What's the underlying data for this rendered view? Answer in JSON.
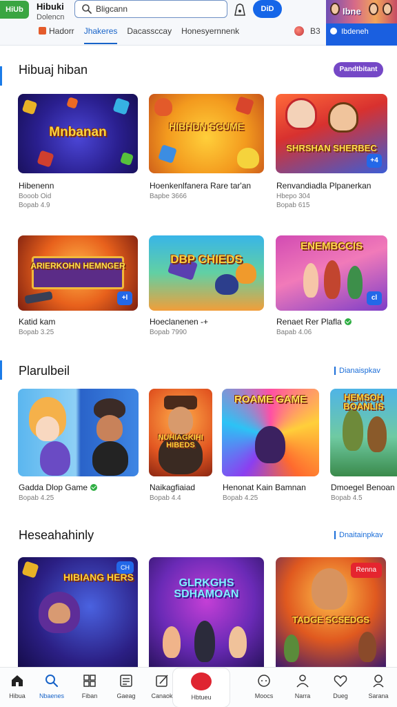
{
  "header": {
    "logo_text": "HiUb",
    "brand_title": "Hibuki",
    "brand_sub": "Dolencn",
    "search_value": "Bligcann",
    "go_label": "DiD",
    "nav_links": [
      "Hadorr",
      "Jhakeres",
      "Dacassccay",
      "Honesyernnenk"
    ],
    "count": "B3"
  },
  "promo": {
    "title": "Ibne",
    "label": "Ibdeneh"
  },
  "sections": [
    {
      "title": "Hibuaj hiban",
      "action": "Pandtbitant",
      "cards": [
        {
          "thumb_title": "Mnbanan",
          "name": "Hibenenn",
          "meta1": "Booob Oid",
          "meta2": "Bopab 4.9",
          "badge": ""
        },
        {
          "thumb_title": "HIBHDN SCUME",
          "name": "Hoenkenlfanera Rare tar'an",
          "meta1": "Bapbe 3666",
          "meta2": "",
          "badge": ""
        },
        {
          "thumb_title": "SHRSHAN SHERBEC",
          "name": "Renvandiadla Plpanerkan",
          "meta1": "Hbepo 304",
          "meta2": "Bopab 615",
          "badge": "+4"
        }
      ]
    },
    {
      "title": "",
      "action": "",
      "cards": [
        {
          "thumb_title": "ARIERKOHN HEMNGER",
          "name": "Katid kam",
          "meta1": "Bopab 3.25",
          "meta2": "",
          "badge": "+l"
        },
        {
          "thumb_title": "DBP CHIEDS",
          "name": "Hoeclanenen -+",
          "meta1": "Bopab 7990",
          "meta2": "",
          "badge": ""
        },
        {
          "thumb_title": "ENEMBCCIS",
          "name": "Renaet Rer Plafla",
          "meta1": "Bapab 4.06",
          "meta2": "",
          "badge": "cl"
        }
      ]
    },
    {
      "title": "Plarulbeil",
      "action": "Dianaispkav",
      "cards": [
        {
          "thumb_title": "",
          "name": "Gadda Dlop Game",
          "meta1": "Bopab 4.25",
          "meta2": "",
          "badge": ""
        },
        {
          "thumb_title": "NUHIAGKIHI HIBEDS",
          "name": "Naikagfiaiad",
          "meta1": "Bopab 4.4",
          "meta2": "",
          "badge": ""
        },
        {
          "thumb_title": "ROAME GAME",
          "name": "Henonat Kain Bamnan",
          "meta1": "Bopab 4.25",
          "meta2": "",
          "badge": ""
        },
        {
          "thumb_title": "HEMSOH BOANLIS",
          "name": "Dmoegel Benoan",
          "meta1": "Bopab 4.5",
          "meta2": "",
          "badge": ""
        }
      ]
    },
    {
      "title": "Heseahahinly",
      "action": "Dnaitainpkav",
      "cards": [
        {
          "thumb_title": "HIBIANG HERS",
          "name": "",
          "meta1": "",
          "meta2": "",
          "badge": "CH"
        },
        {
          "thumb_title": "GLRKGHS SDHAMOAN",
          "name": "",
          "meta1": "",
          "meta2": "",
          "badge": ""
        },
        {
          "thumb_title": "TADGE SCSEDGS",
          "name": "",
          "meta1": "",
          "meta2": "",
          "badge": "Renna"
        }
      ]
    }
  ],
  "bottom_nav": [
    "Hibua",
    "Nbaenes",
    "Fiban",
    "Gaeag",
    "Canaok",
    "Hbtueu",
    "Moocs",
    "Narra",
    "Dueg",
    "Sarana"
  ],
  "colors": {
    "accent": "#1763c8",
    "brand_green": "#3aa541",
    "purple": "#7548c6",
    "red": "#df2531"
  }
}
